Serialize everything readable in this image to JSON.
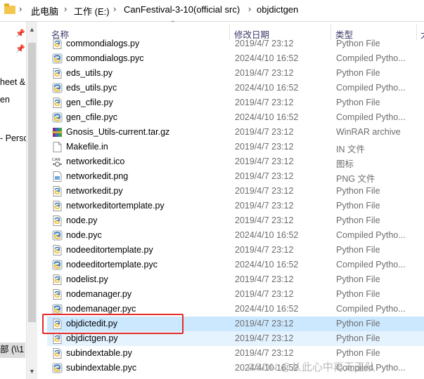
{
  "breadcrumb": [
    "此电脑",
    "工作 (E:)",
    "CanFestival-3-10(official src)",
    "objdictgen"
  ],
  "breadcrumb_separator": "›",
  "columns": {
    "name": "名称",
    "date": "修改日期",
    "type": "类型",
    "size": "大"
  },
  "nav_pane": {
    "items": [
      "heet &",
      "en",
      "- Perso",
      "部 (\\\\1"
    ]
  },
  "files": [
    {
      "name": "commondialogs.py",
      "date": "2019/4/7 23:12",
      "type": "Python File",
      "icon": "python-file-icon"
    },
    {
      "name": "commondialogs.pyc",
      "date": "2024/4/10 16:52",
      "type": "Compiled Pytho...",
      "icon": "compiled-python-icon"
    },
    {
      "name": "eds_utils.py",
      "date": "2019/4/7 23:12",
      "type": "Python File",
      "icon": "python-file-icon"
    },
    {
      "name": "eds_utils.pyc",
      "date": "2024/4/10 16:52",
      "type": "Compiled Pytho...",
      "icon": "compiled-python-icon"
    },
    {
      "name": "gen_cfile.py",
      "date": "2019/4/7 23:12",
      "type": "Python File",
      "icon": "python-file-icon"
    },
    {
      "name": "gen_cfile.pyc",
      "date": "2024/4/10 16:52",
      "type": "Compiled Pytho...",
      "icon": "compiled-python-icon"
    },
    {
      "name": "Gnosis_Utils-current.tar.gz",
      "date": "2019/4/7 23:12",
      "type": "WinRAR archive",
      "icon": "winrar-archive-icon"
    },
    {
      "name": "Makefile.in",
      "date": "2019/4/7 23:12",
      "type": "IN 文件",
      "icon": "generic-file-icon"
    },
    {
      "name": "networkedit.ico",
      "date": "2019/4/7 23:12",
      "type": "图标",
      "icon": "ico-file-icon"
    },
    {
      "name": "networkedit.png",
      "date": "2019/4/7 23:12",
      "type": "PNG 文件",
      "icon": "png-file-icon"
    },
    {
      "name": "networkedit.py",
      "date": "2019/4/7 23:12",
      "type": "Python File",
      "icon": "python-file-icon"
    },
    {
      "name": "networkeditortemplate.py",
      "date": "2019/4/7 23:12",
      "type": "Python File",
      "icon": "python-file-icon"
    },
    {
      "name": "node.py",
      "date": "2019/4/7 23:12",
      "type": "Python File",
      "icon": "python-file-icon"
    },
    {
      "name": "node.pyc",
      "date": "2024/4/10 16:52",
      "type": "Compiled Pytho...",
      "icon": "compiled-python-icon"
    },
    {
      "name": "nodeeditortemplate.py",
      "date": "2019/4/7 23:12",
      "type": "Python File",
      "icon": "python-file-icon"
    },
    {
      "name": "nodeeditortemplate.pyc",
      "date": "2024/4/10 16:52",
      "type": "Compiled Pytho...",
      "icon": "compiled-python-icon"
    },
    {
      "name": "nodelist.py",
      "date": "2019/4/7 23:12",
      "type": "Python File",
      "icon": "python-file-icon"
    },
    {
      "name": "nodemanager.py",
      "date": "2019/4/7 23:12",
      "type": "Python File",
      "icon": "python-file-icon"
    },
    {
      "name": "nodemanager.pyc",
      "date": "2024/4/10 16:52",
      "type": "Compiled Pytho...",
      "icon": "compiled-python-icon"
    },
    {
      "name": "objdictedit.py",
      "date": "2019/4/7 23:12",
      "type": "Python File",
      "icon": "python-file-icon",
      "state": "selected"
    },
    {
      "name": "objdictgen.py",
      "date": "2019/4/7 23:12",
      "type": "Python File",
      "icon": "python-file-icon",
      "state": "hover"
    },
    {
      "name": "subindextable.py",
      "date": "2019/4/7 23:12",
      "type": "Python File",
      "icon": "python-file-icon"
    },
    {
      "name": "subindextable.pyc",
      "date": "2024/4/10 16:52",
      "type": "Compiled Pytho...",
      "icon": "compiled-python-icon"
    }
  ],
  "watermark": "CSDN @从此心中再无玉队",
  "colors": {
    "selected_row": "#cce8ff",
    "hover_row": "#e5f3ff",
    "highlight_box": "#e52b2b"
  }
}
